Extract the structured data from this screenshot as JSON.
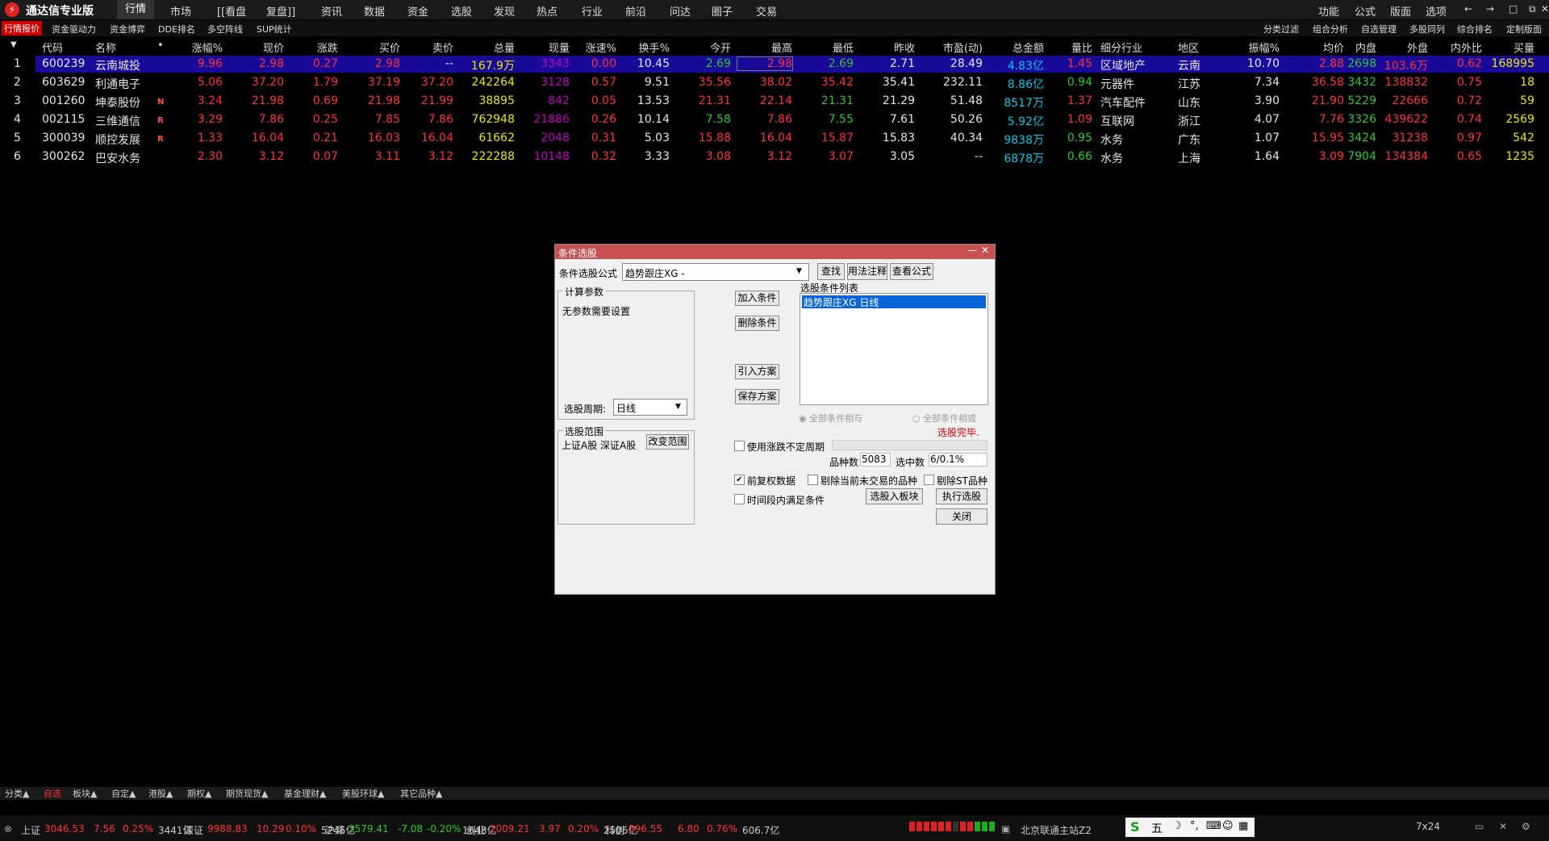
{
  "app_title": "通达信专业版",
  "menu": [
    "行情",
    "市场",
    "[[看盘",
    "复盘]]",
    "资讯",
    "数据",
    "资金",
    "选股",
    "发现",
    "热点",
    "行业",
    "前沿",
    "问达",
    "圈子",
    "交易"
  ],
  "right_menu": [
    "功能",
    "公式",
    "版面",
    "选项"
  ],
  "window_icons": [
    "←",
    "→",
    "□",
    "⧉",
    "✕"
  ],
  "subtabs": [
    "行情报价",
    "资金驱动力",
    "资金博弈",
    "DDE排名",
    "多空阵线",
    "SUP统计"
  ],
  "right_subtabs": [
    "分类过滤",
    "组合分析",
    "自选管理",
    "多股同列",
    "综合排名",
    "定制版面"
  ],
  "columns": [
    "代码",
    "名称",
    "•",
    "涨幅%",
    "现价",
    "涨跌",
    "买价",
    "卖价",
    "总量",
    "现量",
    "涨速%",
    "换手%",
    "今开",
    "最高",
    "最低",
    "昨收",
    "市盈(动)",
    "总金额",
    "量比",
    "细分行业",
    "地区",
    "振幅%",
    "均价",
    "内盘",
    "外盘",
    "内外比",
    "买量"
  ],
  "rows": [
    {
      "idx": "1",
      "code": "600239",
      "name": "云南城投",
      "flag": "",
      "pct": "9.96",
      "price": "2.98",
      "chg": "0.27",
      "bid": "2.98",
      "ask": "--",
      "vol": "167.9万",
      "cur": "3343",
      "speed": "0.00",
      "turn": "10.45",
      "open": "2.69",
      "high": "2.98",
      "low": "2.69",
      "prev": "2.71",
      "pe": "28.49",
      "amt": "4.83亿",
      "vr": "1.45",
      "ind": "区域地产",
      "region": "云南",
      "amp": "10.70",
      "avg": "2.88",
      "inner": "2698",
      "outer": "103.6万",
      "ioratio": "0.62",
      "bidvol": "168995"
    },
    {
      "idx": "2",
      "code": "603629",
      "name": "利通电子",
      "flag": "",
      "pct": "5.06",
      "price": "37.20",
      "chg": "1.79",
      "bid": "37.19",
      "ask": "37.20",
      "vol": "242264",
      "cur": "3128",
      "speed": "0.57",
      "turn": "9.51",
      "open": "35.56",
      "high": "38.02",
      "low": "35.42",
      "prev": "35.41",
      "pe": "232.11",
      "amt": "8.86亿",
      "vr": "0.94",
      "ind": "元器件",
      "region": "江苏",
      "amp": "7.34",
      "avg": "36.58",
      "inner": "3432",
      "outer": "138832",
      "ioratio": "0.75",
      "bidvol": "18"
    },
    {
      "idx": "3",
      "code": "001260",
      "name": "坤泰股份",
      "flag": "N",
      "pct": "3.24",
      "price": "21.98",
      "chg": "0.69",
      "bid": "21.98",
      "ask": "21.99",
      "vol": "38895",
      "cur": "842",
      "speed": "0.05",
      "turn": "13.53",
      "open": "21.31",
      "high": "22.14",
      "low": "21.31",
      "prev": "21.29",
      "pe": "51.48",
      "amt": "8517万",
      "vr": "1.37",
      "ind": "汽车配件",
      "region": "山东",
      "amp": "3.90",
      "avg": "21.90",
      "inner": "5229",
      "outer": "22666",
      "ioratio": "0.72",
      "bidvol": "59"
    },
    {
      "idx": "4",
      "code": "002115",
      "name": "三维通信",
      "flag": "R",
      "pct": "3.29",
      "price": "7.86",
      "chg": "0.25",
      "bid": "7.85",
      "ask": "7.86",
      "vol": "762948",
      "cur": "21886",
      "speed": "0.26",
      "turn": "10.14",
      "open": "7.58",
      "high": "7.86",
      "low": "7.55",
      "prev": "7.61",
      "pe": "50.26",
      "amt": "5.92亿",
      "vr": "1.09",
      "ind": "互联网",
      "region": "浙江",
      "amp": "4.07",
      "avg": "7.76",
      "inner": "3326",
      "outer": "439622",
      "ioratio": "0.74",
      "bidvol": "2569"
    },
    {
      "idx": "5",
      "code": "300039",
      "name": "顺控发展",
      "flag": "R",
      "pct": "1.33",
      "price": "16.04",
      "chg": "0.21",
      "bid": "16.03",
      "ask": "16.04",
      "vol": "61662",
      "cur": "2048",
      "speed": "0.31",
      "turn": "5.03",
      "open": "15.88",
      "high": "16.04",
      "low": "15.87",
      "prev": "15.83",
      "pe": "40.34",
      "amt": "9838万",
      "vr": "0.95",
      "ind": "水务",
      "region": "广东",
      "amp": "1.07",
      "avg": "15.95",
      "inner": "3424",
      "outer": "31238",
      "ioratio": "0.97",
      "bidvol": "542"
    },
    {
      "idx": "6",
      "code": "300262",
      "name": "巴安水务",
      "flag": "",
      "pct": "2.30",
      "price": "3.12",
      "chg": "0.07",
      "bid": "3.11",
      "ask": "3.12",
      "vol": "222288",
      "cur": "10148",
      "speed": "0.32",
      "turn": "3.33",
      "open": "3.08",
      "high": "3.12",
      "low": "3.07",
      "prev": "3.05",
      "pe": "--",
      "amt": "6878万",
      "vr": "0.66",
      "ind": "水务",
      "region": "上海",
      "amp": "1.64",
      "avg": "3.09",
      "inner": "7904",
      "outer": "134384",
      "ioratio": "0.65",
      "bidvol": "1235"
    }
  ],
  "dialog": {
    "title": "条件选股",
    "formula_label": "条件选股公式",
    "formula_value": "趋势跟庄XG   -",
    "find": "查找",
    "usage": "用法注释",
    "view": "查看公式",
    "params_group": "计算参数",
    "params_text": "无参数需要设置",
    "period_label": "选股周期:",
    "period_value": "日线",
    "add": "加入条件",
    "del": "删除条件",
    "import": "引入方案",
    "save": "保存方案",
    "list_label": "选股条件列表",
    "list_item": "趋势跟庄XG  日线",
    "radio_and": "全部条件相与",
    "radio_or": "全部条件相或",
    "done": "选股完毕.",
    "range_group": "选股范围",
    "range_value": "上证A股 深证A股",
    "change_range": "改变范围",
    "use_period": "使用涨跌不定周期",
    "count_label": "品种数",
    "count_value": "5083",
    "selected_label": "选中数",
    "selected_value": "6/0.1%",
    "fq": "前复权数据",
    "rm_notrade": "剔除当前未交易的品种",
    "rm_st": "剔除ST品种",
    "period_cond": "时间段内满足条件",
    "to_block": "选股入板块",
    "run": "执行选股",
    "close": "关闭"
  },
  "bottom_tabs": [
    "分类▲",
    "自选",
    "板块▲",
    "自定▲",
    "港股▲",
    "期权▲",
    "期货现货▲",
    "基金理财▲",
    "美股环球▲",
    "其它品种▲"
  ],
  "status": [
    {
      "label": "上证",
      "v": "3046.53",
      "c": "7.56",
      "p": "0.25%",
      "a": "3441亿"
    },
    {
      "label": "深证",
      "v": "9988.83",
      "c": "10.29",
      "p": "0.10%",
      "a": "5245亿"
    },
    {
      "label": "沪深",
      "v": "3579.41",
      "c": "-7.08",
      "p": "-0.20%",
      "a": "1648亿"
    },
    {
      "label": "创业",
      "v": "2009.21",
      "c": "3.97",
      "p": "0.20%",
      "a": "2506亿"
    },
    {
      "label": "科创",
      "v": "896.55",
      "c": "6.80",
      "p": "0.76%",
      "a": "606.7亿"
    }
  ],
  "server": "北京联通主站Z2",
  "ime": "五",
  "clock": "7x24"
}
